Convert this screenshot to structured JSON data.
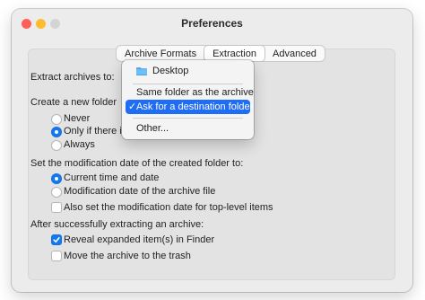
{
  "window": {
    "title": "Preferences",
    "traffic_lights": [
      {
        "name": "close",
        "color": "#ff5f57"
      },
      {
        "name": "minimize",
        "color": "#febc2e"
      },
      {
        "name": "zoom",
        "color": "#d4d4d4"
      }
    ]
  },
  "tabs": [
    {
      "label": "Archive Formats",
      "selected": false
    },
    {
      "label": "Extraction",
      "selected": true
    },
    {
      "label": "Advanced",
      "selected": false
    }
  ],
  "extract_to": {
    "label": "Extract archives to:",
    "selected": "Ask for a destination folder",
    "menu": {
      "desktop": {
        "label": "Desktop",
        "icon": "folder-icon"
      },
      "same_folder": {
        "label": "Same folder as the archive"
      },
      "ask": {
        "label": "Ask for a destination folder",
        "checked": true,
        "check_glyph": "✓"
      },
      "other": {
        "label": "Other..."
      }
    }
  },
  "create_folder": {
    "label": "Create a new folder",
    "options": [
      "Never",
      "Only if there is",
      "Always"
    ],
    "selected": "Only if there is"
  },
  "modification_date": {
    "label": "Set the modification date of the created folder to:",
    "options": [
      "Current time and date",
      "Modification date of the archive file"
    ],
    "selected": "Current time and date",
    "also_top_level": {
      "label": "Also set the modification date for top-level items",
      "checked": false
    }
  },
  "after_extract": {
    "label": "After successfully extracting an archive:",
    "reveal": {
      "label": "Reveal expanded item(s) in Finder",
      "checked": true
    },
    "trash": {
      "label": "Move the archive to the trash",
      "checked": false
    }
  },
  "accent_color": "#1478f0"
}
